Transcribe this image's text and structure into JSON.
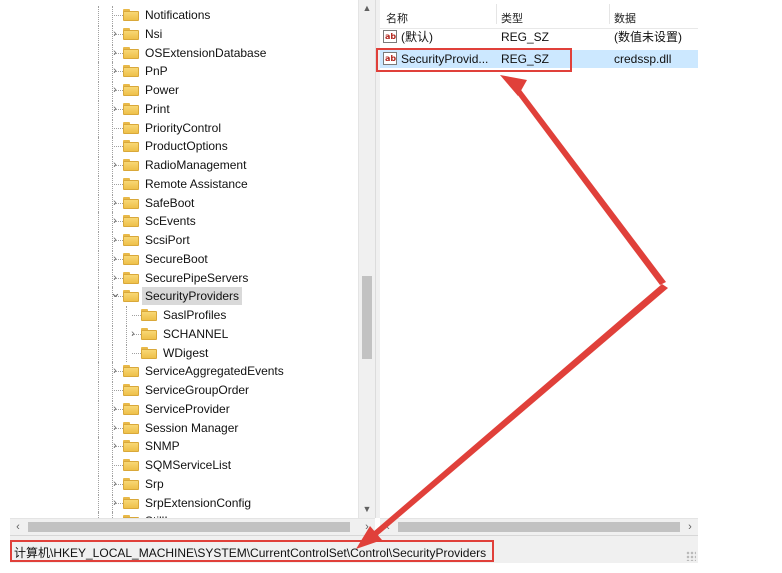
{
  "tree": {
    "items": [
      {
        "label": "Notifications",
        "depth": 0,
        "expander": false,
        "selected": false
      },
      {
        "label": "Nsi",
        "depth": 0,
        "expander": true,
        "selected": false
      },
      {
        "label": "OSExtensionDatabase",
        "depth": 0,
        "expander": true,
        "selected": false
      },
      {
        "label": "PnP",
        "depth": 0,
        "expander": true,
        "selected": false
      },
      {
        "label": "Power",
        "depth": 0,
        "expander": true,
        "selected": false
      },
      {
        "label": "Print",
        "depth": 0,
        "expander": true,
        "selected": false
      },
      {
        "label": "PriorityControl",
        "depth": 0,
        "expander": false,
        "selected": false
      },
      {
        "label": "ProductOptions",
        "depth": 0,
        "expander": false,
        "selected": false
      },
      {
        "label": "RadioManagement",
        "depth": 0,
        "expander": true,
        "selected": false
      },
      {
        "label": "Remote Assistance",
        "depth": 0,
        "expander": false,
        "selected": false
      },
      {
        "label": "SafeBoot",
        "depth": 0,
        "expander": true,
        "selected": false
      },
      {
        "label": "ScEvents",
        "depth": 0,
        "expander": true,
        "selected": false
      },
      {
        "label": "ScsiPort",
        "depth": 0,
        "expander": true,
        "selected": false
      },
      {
        "label": "SecureBoot",
        "depth": 0,
        "expander": true,
        "selected": false
      },
      {
        "label": "SecurePipeServers",
        "depth": 0,
        "expander": true,
        "selected": false
      },
      {
        "label": "SecurityProviders",
        "depth": 0,
        "expander": "open",
        "selected": true
      },
      {
        "label": "SaslProfiles",
        "depth": 1,
        "expander": false,
        "selected": false
      },
      {
        "label": "SCHANNEL",
        "depth": 1,
        "expander": true,
        "selected": false
      },
      {
        "label": "WDigest",
        "depth": 1,
        "expander": false,
        "selected": false
      },
      {
        "label": "ServiceAggregatedEvents",
        "depth": 0,
        "expander": true,
        "selected": false
      },
      {
        "label": "ServiceGroupOrder",
        "depth": 0,
        "expander": false,
        "selected": false
      },
      {
        "label": "ServiceProvider",
        "depth": 0,
        "expander": true,
        "selected": false
      },
      {
        "label": "Session Manager",
        "depth": 0,
        "expander": true,
        "selected": false
      },
      {
        "label": "SNMP",
        "depth": 0,
        "expander": true,
        "selected": false
      },
      {
        "label": "SQMServiceList",
        "depth": 0,
        "expander": false,
        "selected": false
      },
      {
        "label": "Srp",
        "depth": 0,
        "expander": true,
        "selected": false
      },
      {
        "label": "SrpExtensionConfig",
        "depth": 0,
        "expander": true,
        "selected": false
      },
      {
        "label": "StillImage",
        "depth": 0,
        "expander": true,
        "selected": false
      }
    ]
  },
  "list": {
    "columns": [
      "名称",
      "类型",
      "数据"
    ],
    "rows": [
      {
        "name": "(默认)",
        "type": "REG_SZ",
        "data": "(数值未设置)",
        "selected": false
      },
      {
        "name": "SecurityProvid...",
        "type": "REG_SZ",
        "data": "credssp.dll",
        "selected": true
      }
    ]
  },
  "status": {
    "path": "计算机\\HKEY_LOCAL_MACHINE\\SYSTEM\\CurrentControlSet\\Control\\SecurityProviders"
  },
  "icons": {
    "folder": "folder-icon",
    "string_value": "reg-string-icon",
    "expand": "chevron-right-icon",
    "collapse": "chevron-down-icon"
  },
  "colors": {
    "selection": "#cce8ff",
    "tree_selection": "#d9d9d9",
    "annotation_red": "#e0403a",
    "folder_yellow": "#f8d775"
  }
}
